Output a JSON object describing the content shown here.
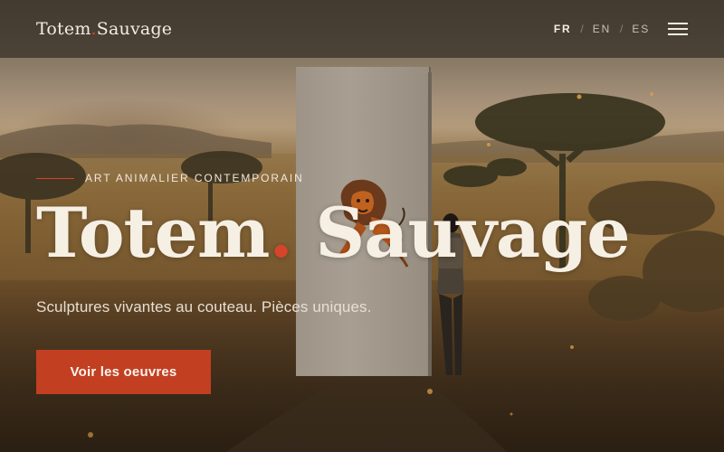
{
  "header": {
    "logo_text": "Totem",
    "logo_text_2": "Sauvage",
    "languages": [
      {
        "code": "FR",
        "active": true
      },
      {
        "code": "EN",
        "active": false
      },
      {
        "code": "ES",
        "active": false
      }
    ],
    "separator": "/",
    "menu_icon": "hamburger-icon"
  },
  "hero": {
    "eyebrow": "ART ANIMALIER CONTEMPORAIN",
    "title_part_1": "Totem",
    "title_part_2": "Sauvage",
    "subtitle": "Sculptures vivantes au couteau. Pièces uniques.",
    "cta_label": "Voir les oeuvres"
  },
  "colors": {
    "accent": "#c23f22",
    "text_light": "#f6efe4",
    "header_bg": "#28221c"
  }
}
